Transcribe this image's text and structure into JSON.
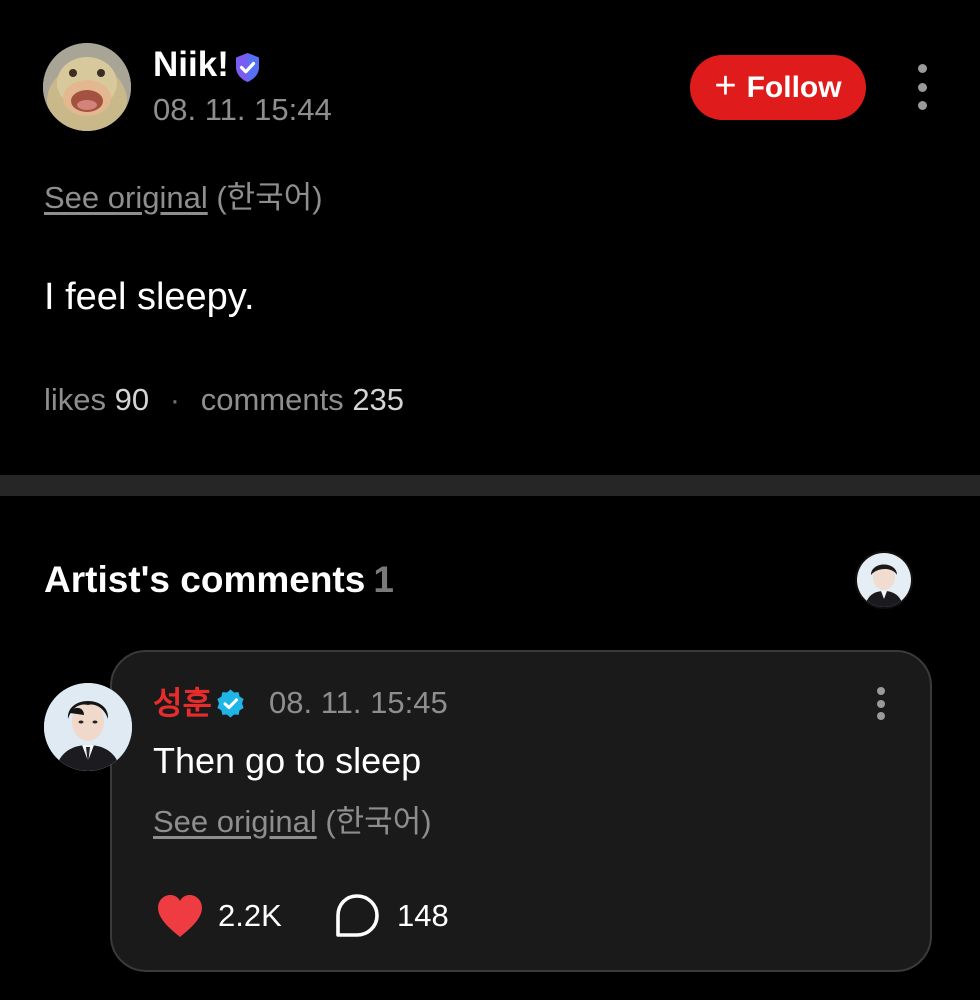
{
  "post": {
    "author_name": "Niik!",
    "timestamp": "08. 11. 15:44",
    "follow_label": "Follow",
    "follow_plus": "+",
    "see_original_label": "See original",
    "original_language": "(한국어)",
    "body": "I feel sleepy.",
    "likes_label": "likes",
    "likes_count": "90",
    "separator": "·",
    "comments_label": "comments",
    "comments_count": "235"
  },
  "artist_comments": {
    "title": "Artist's comments",
    "count": "1",
    "comment": {
      "author_name": "성훈",
      "timestamp": "08. 11. 15:45",
      "text": "Then go to sleep",
      "see_original_label": "See original",
      "original_language": "(한국어)",
      "likes": "2.2K",
      "replies": "148"
    }
  },
  "icons": {
    "verified_shield": "verified-shield-icon",
    "verified_badge": "verified-badge-icon",
    "more": "more-vertical-icon",
    "like": "heart-icon",
    "reply": "comment-bubble-icon"
  },
  "colors": {
    "background": "#000000",
    "accent": "#e01b1b",
    "artist_name": "#e82c2c",
    "card": "#1a1a1a",
    "heart": "#ef3b42",
    "verified_shield": "#7b5cf0",
    "verified_badge": "#1fb5e6"
  }
}
